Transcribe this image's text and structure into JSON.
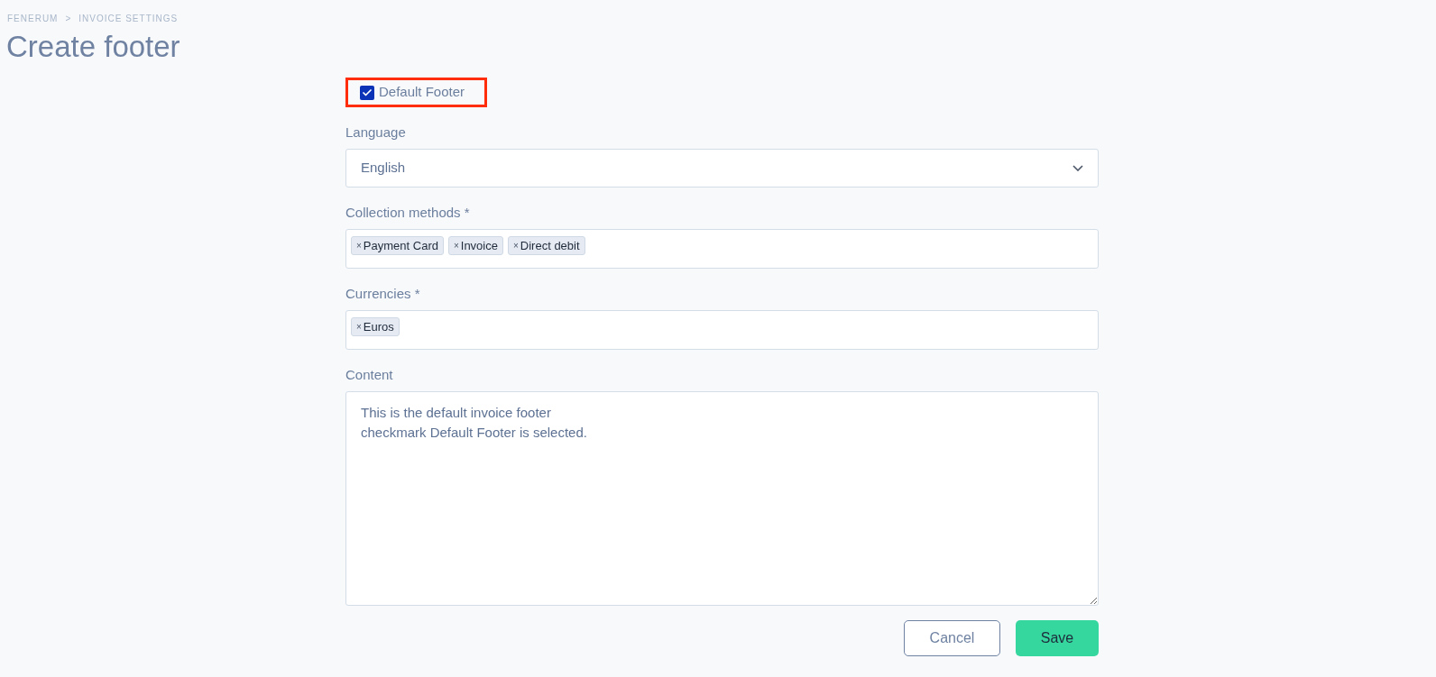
{
  "breadcrumb": [
    "FENERUM",
    "INVOICE SETTINGS"
  ],
  "breadcrumb_separator": ">",
  "title": "Create footer",
  "default_footer": {
    "label": "Default Footer",
    "checked": true,
    "highlighted": true
  },
  "language": {
    "label": "Language",
    "value": "English"
  },
  "collection_methods": {
    "label": "Collection methods *",
    "tags": [
      "Payment Card",
      "Invoice",
      "Direct debit"
    ]
  },
  "currencies": {
    "label": "Currencies *",
    "tags": [
      "Euros"
    ]
  },
  "content": {
    "label": "Content",
    "value": "This is the default invoice footer\ncheckmark Default Footer is selected."
  },
  "buttons": {
    "cancel": "Cancel",
    "save": "Save"
  },
  "tag_remove": "×"
}
